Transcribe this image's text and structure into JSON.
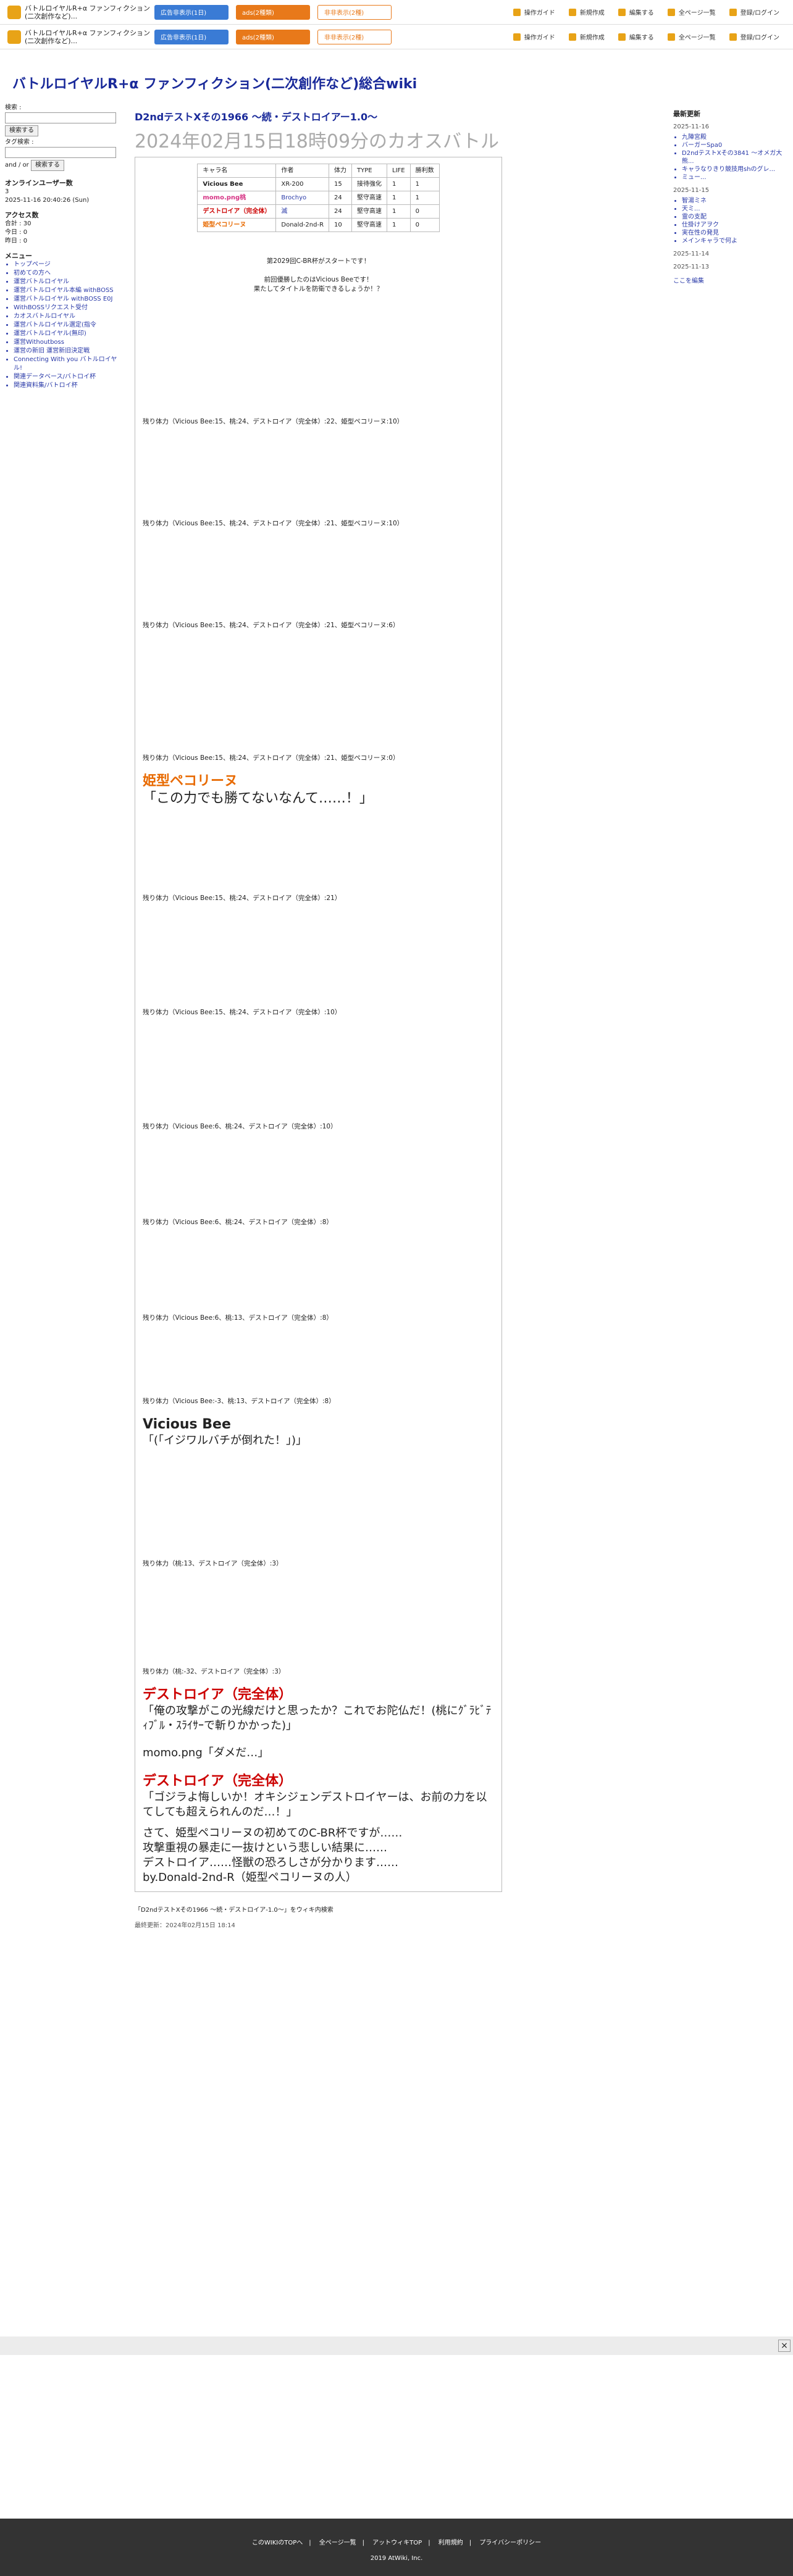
{
  "topbar": {
    "title": "バトルロイヤルR+α ファンフィクション(二次創作など)...",
    "ad_hide": "広告非表示(1日)",
    "ad_hide2": "ads(2種類)",
    "ad_hide3": "非非表示(2種)",
    "edit_guide": "操作ガイド",
    "new": "新規作成",
    "edit": "編集する",
    "all_pages": "全ページ一覧",
    "login": "登録/ログイン"
  },
  "site_title": "バトルロイヤルR+α ファンフィクション(二次創作など)総合wiki",
  "left": {
    "search_label": "検索 :",
    "search_btn": "検索する",
    "tag_label": "タグ検索 :",
    "tag_btn": "検索する",
    "and": "and",
    "or": "or",
    "online": "オンラインユーザー数",
    "online_n": "3",
    "date": "2025-11-16 20:40:26 (Sun)",
    "access": "アクセス数",
    "total": "合計 : 30",
    "today": "今日 : 0",
    "yesterday": "昨日 : 0",
    "menu": "メニュー",
    "menu_items": [
      "トップページ",
      "初めての方へ",
      "運営バトルロイヤル",
      "運営バトルロイヤル本編 withBOSS",
      "運営バトルロイヤル withBOSS E0J",
      "WithBOSSリクエスト受付",
      "カオスバトルロイヤル",
      "運営バトルロイヤル選定(指令",
      "運営バトルロイヤル(無印)",
      "運営Withoutboss",
      "運営の新旧 運営新旧決定戦",
      "Connecting With you バトルロイヤル!",
      "関連データベース/バトロイ杯",
      "関連資料集/バトロイ杯"
    ]
  },
  "right": {
    "title": "最新更新",
    "d1": "2025-11-16",
    "l1": [
      "九陣宮殿",
      "バーガーSpa0",
      "D2ndテストXその3841 〜オメガ大熊...",
      "キャラなりきり競技用shのグレ...",
      "ミュー..."
    ],
    "d2": "2025-11-15",
    "l2": [
      "智湯ミネ",
      "天ミ...",
      "霊の支配",
      "仕掛けアヲク",
      "実在性の発見",
      "メインキャラで何よ"
    ],
    "d3": "2025-11-14",
    "d4": "2025-11-13",
    "more": "ここを編集"
  },
  "main": {
    "title": "D2ndテストXその1966 〜続・デストロイアー1.0〜",
    "subtitle": "2024年02月15日18時09分のカオスバトル"
  },
  "table": {
    "headers": [
      "キャラ名",
      "作者",
      "体力",
      "TYPE",
      "LIFE",
      "勝利数"
    ],
    "rows": [
      [
        "Vicious Bee",
        "XR-200",
        "15",
        "接待強化",
        "1",
        "1"
      ],
      [
        "momo.png桃",
        "Brochyo",
        "24",
        "堅守高速",
        "1",
        "1"
      ],
      [
        "デストロイア（完全体）",
        "滅",
        "24",
        "堅守高速",
        "1",
        "0"
      ],
      [
        "姫型ペコリーヌ",
        "Donald-2nd-R",
        "10",
        "堅守高速",
        "1",
        "0"
      ]
    ]
  },
  "log": {
    "start": "第2029回C-BR杯がスタートです！",
    "intro1": "前回優勝したのはVicious Beeです！",
    "intro2": "果たしてタイトルを防衛できるしょうか！？",
    "hp1": "残り体力（Vicious Bee:15、桃:24、デストロイア（完全体）:22、姫型ペコリーヌ:10）",
    "hp2": "残り体力（Vicious Bee:15、桃:24、デストロイア（完全体）:21、姫型ペコリーヌ:10）",
    "hp3": "残り体力（Vicious Bee:15、桃:24、デストロイア（完全体）:21、姫型ペコリーヌ:6）",
    "hp4": "残り体力（Vicious Bee:15、桃:24、デストロイア（完全体）:21、姫型ペコリーヌ:0）",
    "big1": "姫型ペコリーヌ",
    "big1b": "「この力でも勝てないなんて……！」",
    "hp5": "残り体力（Vicious Bee:15、桃:24、デストロイア（完全体）:21）",
    "hp6": "残り体力（Vicious Bee:15、桃:24、デストロイア（完全体）:10）",
    "hp7": "残り体力（Vicious Bee:6、桃:24、デストロイア（完全体）:10）",
    "hp8": "残り体力（Vicious Bee:6、桃:24、デストロイア（完全体）:8）",
    "hp9": "残り体力（Vicious Bee:6、桃:13、デストロイア（完全体）:8）",
    "hp10": "残り体力（Vicious Bee:-3、桃:13、デストロイア（完全体）:8）",
    "big2": "Vicious Bee",
    "big2b": "「(「イジワルバチが倒れた！」)」",
    "hp11": "残り体力（桃:13、デストロイア（完全体）:3）",
    "hp12": "残り体力（桃:-32、デストロイア（完全体）:3）",
    "big3": "デストロイア（完全体）",
    "big3b": "「俺の攻撃がこの光線だけと思ったか？これでお陀仏だ！(桃にｸﾞﾗﾋﾞﾃｨﾌﾞﾙ・ｽﾗｲｻｰで斬りかかった)」",
    "momo_end": "momo.png「ダメだ…」",
    "win": "デストロイア（完全体）",
    "winb": "「ゴジラよ悔しいか！オキシジェンデストロイヤーは、お前の力を以てしても超えられんのだ…！」",
    "after1": "さて、姫型ペコリーヌの初めてのC-BR杯ですが……",
    "after2": "攻撃重視の暴走に一抜けという悲しい結果に……",
    "after3": "デストロイア……怪獣の恐ろしさが分かります……",
    "by": "by.Donald-2nd-R（姫型ペコリーヌの人）",
    "bottom_link": "「D2ndテストXその1966 〜続・デストロイア-1.0〜」をウィキ内検索",
    "updated": "最終更新：2024年02月15日 18:14"
  },
  "footer": {
    "items": [
      "このWIKIのTOPへ",
      "全ページ一覧",
      "アットウィキTOP",
      "利用規約",
      "プライバシーポリシー"
    ],
    "copy": "2019 AtWiki, Inc."
  }
}
